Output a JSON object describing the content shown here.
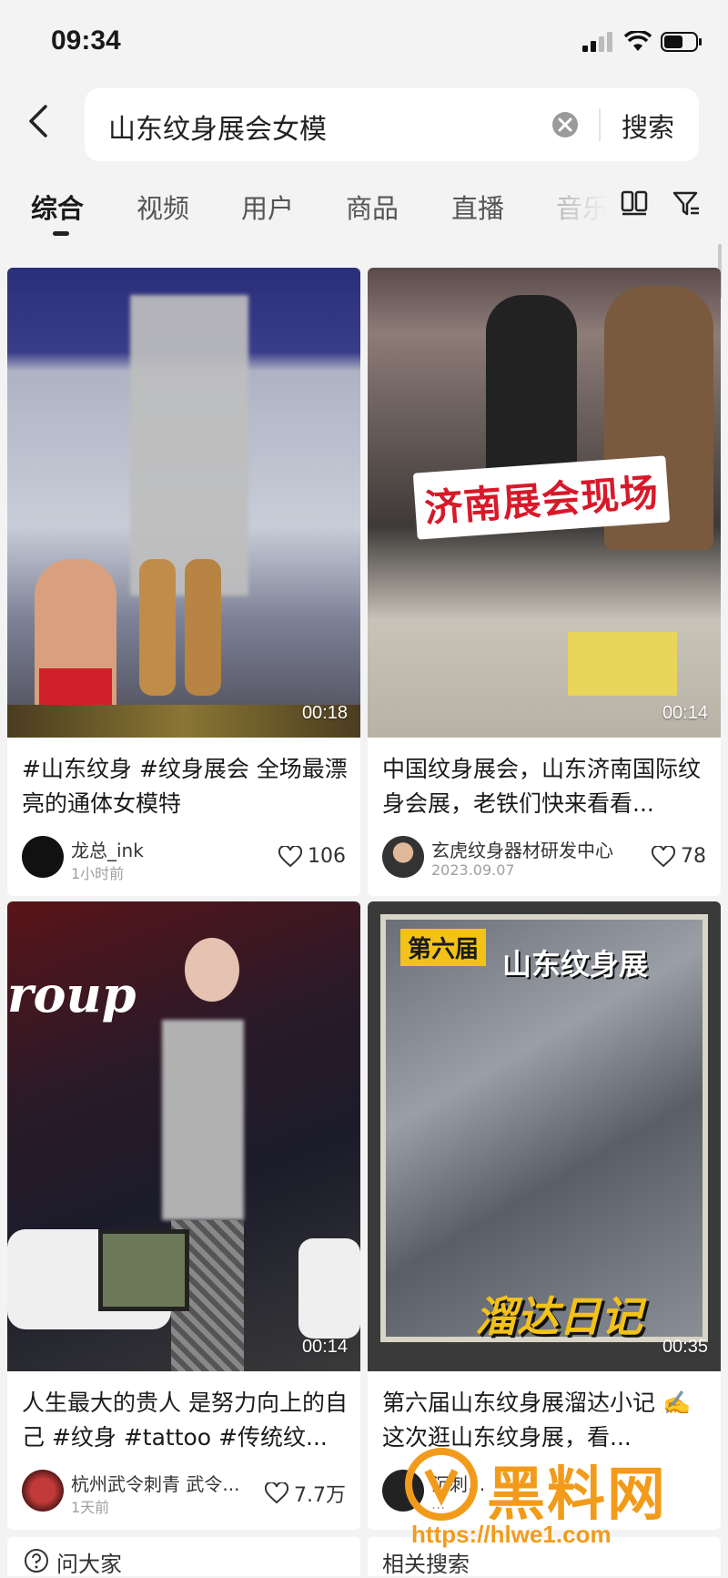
{
  "status_bar": {
    "time": "09:34"
  },
  "search": {
    "query": "山东纹身展会女模",
    "button_label": "搜索"
  },
  "tabs": [
    "综合",
    "视频",
    "用户",
    "商品",
    "直播",
    "音乐"
  ],
  "cards": [
    {
      "duration": "00:18",
      "title": "#山东纹身 #纹身展会 全场最漂亮的通体女模特",
      "author": "龙总_ink",
      "time": "1小时前",
      "likes": "106"
    },
    {
      "duration": "00:14",
      "overlay_text": "济南展会现场",
      "title": "中国纹身展会，山东济南国际纹身会展，老铁们快来看看...",
      "author": "玄虎纹身器材研发中心",
      "time": "2023.09.07",
      "likes": "78"
    },
    {
      "duration": "00:14",
      "thumb_text": "roup",
      "title": "人生最大的贵人 是努力向上的自己 #纹身 #tattoo #传统纹...",
      "author": "杭州武令刺青 武令...",
      "time": "1天前",
      "likes": "7.7万"
    },
    {
      "duration": "00:35",
      "thumb_top_left": "第六届",
      "thumb_top_right": "山东纹身展",
      "thumb_bottom": "溜达日记",
      "title": "第六届山东纹身展溜达小记 ✍️ 这次逛山东纹身展，看...",
      "author": "沉刺...",
      "time": "...",
      "likes": ""
    }
  ],
  "bottom": {
    "left_label": "问大家",
    "right_label": "相关搜索"
  },
  "watermark": {
    "text": "黑料网",
    "url": "https://hlwe1.com"
  },
  "colors": {
    "accent_red": "#d7192a",
    "watermark": "#f29b1b"
  }
}
